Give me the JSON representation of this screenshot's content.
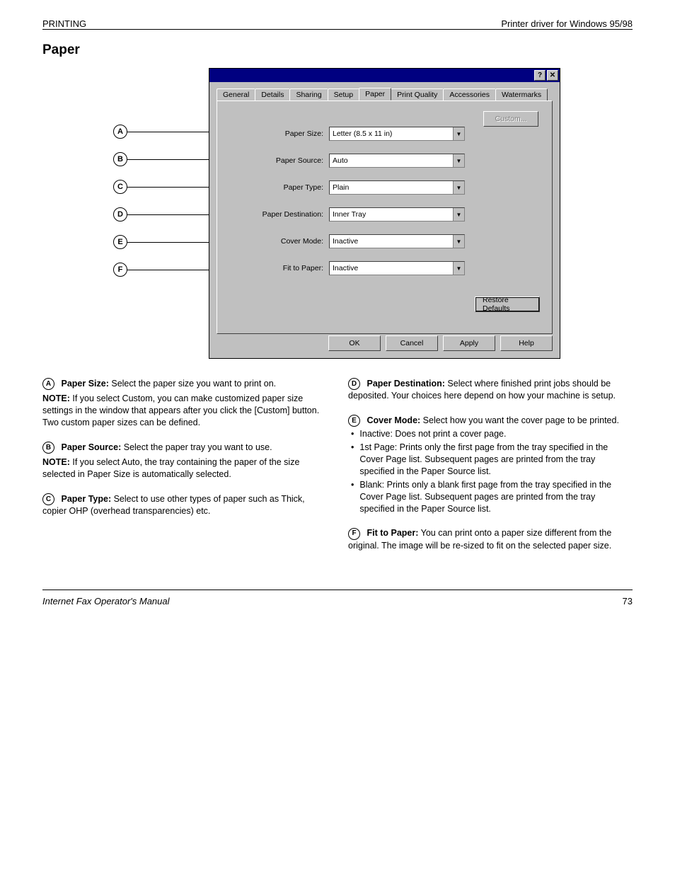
{
  "page_header": {
    "section": "PRINTING",
    "subsection": "Printer driver for Windows 95/98"
  },
  "section_heading": "Paper",
  "dialog": {
    "titlebar_buttons": {
      "help": "?",
      "close": "✕"
    },
    "tabs": [
      "General",
      "Details",
      "Sharing",
      "Setup",
      "Paper",
      "Print Quality",
      "Accessories",
      "Watermarks"
    ],
    "active_tab": "Paper",
    "fields": {
      "paper_size_label": "Paper Size:",
      "paper_size_value": "Letter (8.5 x 11 in)",
      "paper_source_label": "Paper Source:",
      "paper_source_value": "Auto",
      "paper_type_label": "Paper Type:",
      "paper_type_value": "Plain",
      "paper_destination_label": "Paper Destination:",
      "paper_destination_value": "Inner Tray",
      "cover_mode_label": "Cover Mode:",
      "cover_mode_value": "Inactive",
      "fit_to_paper_label": "Fit to Paper:",
      "fit_to_paper_value": "Inactive"
    },
    "custom_button": "Custom...",
    "restore_button": "Restore Defaults",
    "buttons": {
      "ok": "OK",
      "cancel": "Cancel",
      "apply": "Apply",
      "help": "Help"
    }
  },
  "callouts": [
    "A",
    "B",
    "C",
    "D",
    "E",
    "F"
  ],
  "descriptions": {
    "A": {
      "letter": "A",
      "title": "Paper Size:",
      "body": "Select the paper size you want to print on.",
      "note_label": "NOTE:",
      "note": "If you select Custom, you can make customized paper size settings in the window that appears after you click the [Custom] button. Two custom paper sizes can be defined."
    },
    "B": {
      "letter": "B",
      "title": "Paper Source:",
      "body": "Select the paper tray you want to use.",
      "note_label": "NOTE:",
      "note": "If you select Auto, the tray containing the paper of the size selected in Paper Size is automatically selected."
    },
    "C": {
      "letter": "C",
      "title": "Paper Type:",
      "body": "Select to use other types of paper such as Thick, copier OHP (overhead transparencies) etc."
    },
    "D": {
      "letter": "D",
      "title": "Paper Destination:",
      "body": "Select where finished print jobs should be deposited. Your choices here depend on how your machine is setup."
    },
    "E": {
      "letter": "E",
      "title": "Cover Mode:",
      "body": "Select how you want the cover page to be printed.",
      "bullets": [
        "Inactive: Does not print a cover page.",
        "1st Page: Prints only the first page from the tray specified in the Cover Page list. Subsequent pages are printed from the tray specified in the Paper Source list.",
        "Blank: Prints only a blank first page from the tray specified in the Cover Page list. Subsequent pages are printed from the tray specified in the Paper Source list."
      ]
    },
    "F": {
      "letter": "F",
      "title": "Fit to Paper:",
      "body": "You can print onto a paper size different from the original. The image will be re-sized to fit on the selected paper size."
    }
  },
  "footer": {
    "title": "Internet Fax Operator's Manual",
    "page": "73"
  }
}
